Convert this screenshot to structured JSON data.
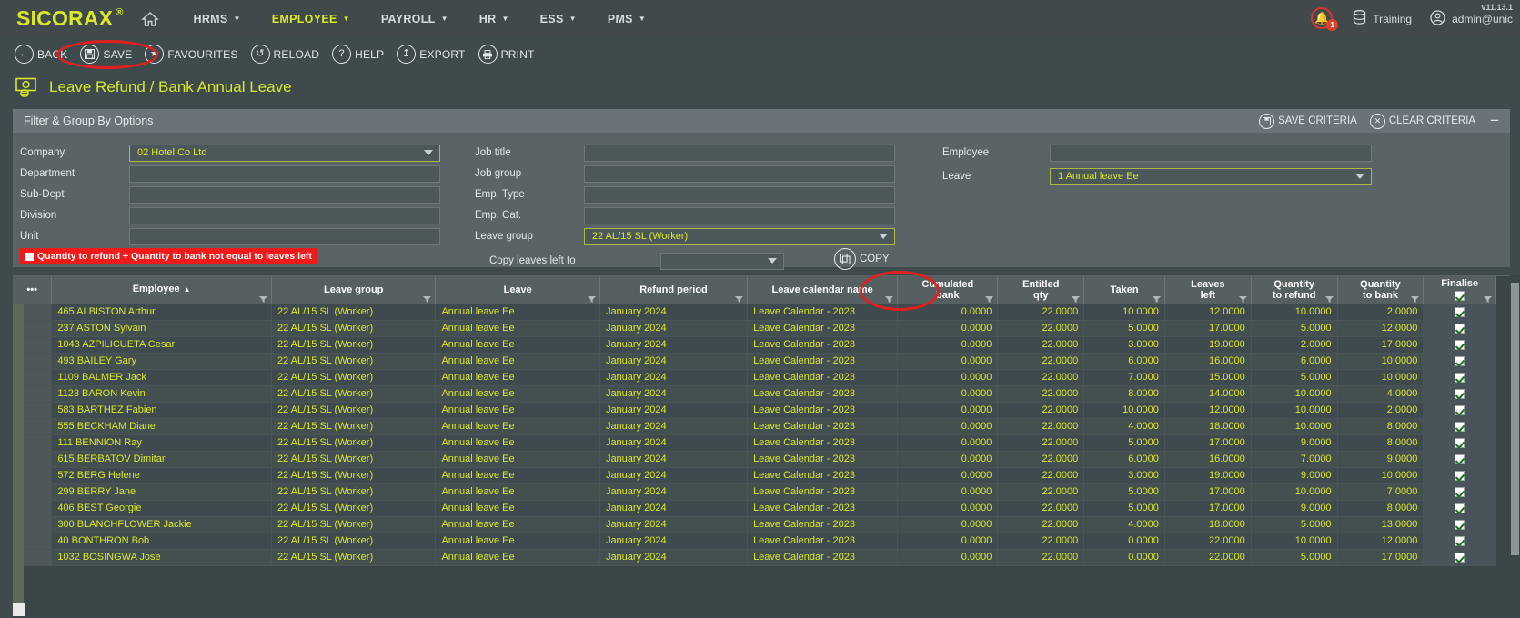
{
  "topnav": {
    "brand": "SICORAX",
    "brand_reg": "®",
    "home_icon": "home-icon",
    "items": [
      {
        "label": "HRMS",
        "active": false
      },
      {
        "label": "EMPLOYEE",
        "active": true
      },
      {
        "label": "PAYROLL",
        "active": false
      },
      {
        "label": "HR",
        "active": false
      },
      {
        "label": "ESS",
        "active": false
      },
      {
        "label": "PMS",
        "active": false
      }
    ],
    "notifications_count": "1",
    "database_label": "Training",
    "user_label": "admin@unic",
    "version": "v11.13.1",
    "progress_colors": [
      "#31a8bf",
      "#e8701a",
      "#e8c420",
      "#8cc44a"
    ]
  },
  "breadcrumb": {
    "module": "EMPLOYEE",
    "separator": "/",
    "page": "Leave refund / bank annual leave"
  },
  "toolbar": {
    "buttons": [
      {
        "label": "BACK",
        "icon": "arrow-left-icon"
      },
      {
        "label": "SAVE",
        "icon": "floppy-disk-icon"
      },
      {
        "label": "FAVOURITES",
        "icon": "star-icon"
      },
      {
        "label": "RELOAD",
        "icon": "refresh-icon"
      },
      {
        "label": "HELP",
        "icon": "question-mark-icon"
      },
      {
        "label": "EXPORT",
        "icon": "upload-icon"
      },
      {
        "label": "PRINT",
        "icon": "printer-icon"
      }
    ]
  },
  "page": {
    "title": "Leave Refund / Bank Annual Leave",
    "title_icon": "money-leave-icon"
  },
  "filter": {
    "header_title": "Filter & Group By Options",
    "save_criteria_label": "SAVE CRITERIA",
    "clear_criteria_label": "CLEAR CRITERIA",
    "collapse_label": "−",
    "left_fields": [
      {
        "label": "Company",
        "value": "02 Hotel Co Ltd",
        "dropdown": true,
        "highlight": true
      },
      {
        "label": "Department",
        "value": "",
        "dropdown": false,
        "highlight": false
      },
      {
        "label": "Sub-Dept",
        "value": "",
        "dropdown": false,
        "highlight": false
      },
      {
        "label": "Division",
        "value": "",
        "dropdown": false,
        "highlight": false
      },
      {
        "label": "Unit",
        "value": "",
        "dropdown": false,
        "highlight": false
      }
    ],
    "mid_fields": [
      {
        "label": "Job title",
        "value": "",
        "dropdown": false,
        "highlight": false
      },
      {
        "label": "Job group",
        "value": "",
        "dropdown": false,
        "highlight": false
      },
      {
        "label": "Emp. Type",
        "value": "",
        "dropdown": false,
        "highlight": false
      },
      {
        "label": "Emp. Cat.",
        "value": "",
        "dropdown": false,
        "highlight": false
      },
      {
        "label": "Leave group",
        "value": "22 AL/15 SL (Worker)",
        "dropdown": true,
        "highlight": true
      }
    ],
    "right_fields": [
      {
        "label": "Employee",
        "value": "",
        "dropdown": false,
        "highlight": false
      },
      {
        "label": "Leave",
        "value": "1 Annual leave Ee",
        "dropdown": true,
        "highlight": true
      }
    ],
    "copy_row": {
      "label": "Copy leaves left to",
      "value": "",
      "button_label": "COPY"
    },
    "warning": "Quantity to refund + Quantity to bank not equal to leaves left"
  },
  "grid": {
    "menu_icon": "ellipsis-icon",
    "columns": [
      {
        "line1": "Employee",
        "line2": "",
        "sorted": "asc"
      },
      {
        "line1": "Leave group",
        "line2": "",
        "sorted": ""
      },
      {
        "line1": "Leave",
        "line2": "",
        "sorted": ""
      },
      {
        "line1": "Refund period",
        "line2": "",
        "sorted": ""
      },
      {
        "line1": "Leave calendar name",
        "line2": "",
        "sorted": ""
      },
      {
        "line1": "Cumulated",
        "line2": "bank",
        "sorted": ""
      },
      {
        "line1": "Entitled",
        "line2": "qty",
        "sorted": ""
      },
      {
        "line1": "Taken",
        "line2": "",
        "sorted": ""
      },
      {
        "line1": "Leaves",
        "line2": "left",
        "sorted": ""
      },
      {
        "line1": "Quantity",
        "line2": "to refund",
        "sorted": ""
      },
      {
        "line1": "Quantity",
        "line2": "to bank",
        "sorted": ""
      },
      {
        "line1": "Finalise",
        "line2": "",
        "sorted": ""
      }
    ],
    "header_checkbox_checked": true,
    "rows": [
      {
        "employee": "465 ALBISTON Arthur",
        "leave_group": "22 AL/15 SL (Worker)",
        "leave": "Annual leave Ee",
        "refund_period": "January 2024",
        "calendar": "Leave Calendar - 2023",
        "cumulated_bank": "0.0000",
        "entitled_qty": "22.0000",
        "taken": "10.0000",
        "leaves_left": "12.0000",
        "qty_refund": "10.0000",
        "qty_bank": "2.0000",
        "finalise": true
      },
      {
        "employee": "237 ASTON Sylvain",
        "leave_group": "22 AL/15 SL (Worker)",
        "leave": "Annual leave Ee",
        "refund_period": "January 2024",
        "calendar": "Leave Calendar - 2023",
        "cumulated_bank": "0.0000",
        "entitled_qty": "22.0000",
        "taken": "5.0000",
        "leaves_left": "17.0000",
        "qty_refund": "5.0000",
        "qty_bank": "12.0000",
        "finalise": true
      },
      {
        "employee": "1043 AZPILICUETA Cesar",
        "leave_group": "22 AL/15 SL (Worker)",
        "leave": "Annual leave Ee",
        "refund_period": "January 2024",
        "calendar": "Leave Calendar - 2023",
        "cumulated_bank": "0.0000",
        "entitled_qty": "22.0000",
        "taken": "3.0000",
        "leaves_left": "19.0000",
        "qty_refund": "2.0000",
        "qty_bank": "17.0000",
        "finalise": true
      },
      {
        "employee": "493 BAILEY Gary",
        "leave_group": "22 AL/15 SL (Worker)",
        "leave": "Annual leave Ee",
        "refund_period": "January 2024",
        "calendar": "Leave Calendar - 2023",
        "cumulated_bank": "0.0000",
        "entitled_qty": "22.0000",
        "taken": "6.0000",
        "leaves_left": "16.0000",
        "qty_refund": "6.0000",
        "qty_bank": "10.0000",
        "finalise": true
      },
      {
        "employee": "1109 BALMER Jack",
        "leave_group": "22 AL/15 SL (Worker)",
        "leave": "Annual leave Ee",
        "refund_period": "January 2024",
        "calendar": "Leave Calendar - 2023",
        "cumulated_bank": "0.0000",
        "entitled_qty": "22.0000",
        "taken": "7.0000",
        "leaves_left": "15.0000",
        "qty_refund": "5.0000",
        "qty_bank": "10.0000",
        "finalise": true
      },
      {
        "employee": "1123 BARON Kevin",
        "leave_group": "22 AL/15 SL (Worker)",
        "leave": "Annual leave Ee",
        "refund_period": "January 2024",
        "calendar": "Leave Calendar - 2023",
        "cumulated_bank": "0.0000",
        "entitled_qty": "22.0000",
        "taken": "8.0000",
        "leaves_left": "14.0000",
        "qty_refund": "10.0000",
        "qty_bank": "4.0000",
        "finalise": true
      },
      {
        "employee": "583 BARTHEZ Fabien",
        "leave_group": "22 AL/15 SL (Worker)",
        "leave": "Annual leave Ee",
        "refund_period": "January 2024",
        "calendar": "Leave Calendar - 2023",
        "cumulated_bank": "0.0000",
        "entitled_qty": "22.0000",
        "taken": "10.0000",
        "leaves_left": "12.0000",
        "qty_refund": "10.0000",
        "qty_bank": "2.0000",
        "finalise": true
      },
      {
        "employee": "555 BECKHAM Diane",
        "leave_group": "22 AL/15 SL (Worker)",
        "leave": "Annual leave Ee",
        "refund_period": "January 2024",
        "calendar": "Leave Calendar - 2023",
        "cumulated_bank": "0.0000",
        "entitled_qty": "22.0000",
        "taken": "4.0000",
        "leaves_left": "18.0000",
        "qty_refund": "10.0000",
        "qty_bank": "8.0000",
        "finalise": true
      },
      {
        "employee": "111 BENNION Ray",
        "leave_group": "22 AL/15 SL (Worker)",
        "leave": "Annual leave Ee",
        "refund_period": "January 2024",
        "calendar": "Leave Calendar - 2023",
        "cumulated_bank": "0.0000",
        "entitled_qty": "22.0000",
        "taken": "5.0000",
        "leaves_left": "17.0000",
        "qty_refund": "9.0000",
        "qty_bank": "8.0000",
        "finalise": true
      },
      {
        "employee": "615 BERBATOV Dimitar",
        "leave_group": "22 AL/15 SL (Worker)",
        "leave": "Annual leave Ee",
        "refund_period": "January 2024",
        "calendar": "Leave Calendar - 2023",
        "cumulated_bank": "0.0000",
        "entitled_qty": "22.0000",
        "taken": "6.0000",
        "leaves_left": "16.0000",
        "qty_refund": "7.0000",
        "qty_bank": "9.0000",
        "finalise": true
      },
      {
        "employee": "572 BERG Helene",
        "leave_group": "22 AL/15 SL (Worker)",
        "leave": "Annual leave Ee",
        "refund_period": "January 2024",
        "calendar": "Leave Calendar - 2023",
        "cumulated_bank": "0.0000",
        "entitled_qty": "22.0000",
        "taken": "3.0000",
        "leaves_left": "19.0000",
        "qty_refund": "9.0000",
        "qty_bank": "10.0000",
        "finalise": true
      },
      {
        "employee": "299 BERRY Jane",
        "leave_group": "22 AL/15 SL (Worker)",
        "leave": "Annual leave Ee",
        "refund_period": "January 2024",
        "calendar": "Leave Calendar - 2023",
        "cumulated_bank": "0.0000",
        "entitled_qty": "22.0000",
        "taken": "5.0000",
        "leaves_left": "17.0000",
        "qty_refund": "10.0000",
        "qty_bank": "7.0000",
        "finalise": true
      },
      {
        "employee": "406 BEST Georgie",
        "leave_group": "22 AL/15 SL (Worker)",
        "leave": "Annual leave Ee",
        "refund_period": "January 2024",
        "calendar": "Leave Calendar - 2023",
        "cumulated_bank": "0.0000",
        "entitled_qty": "22.0000",
        "taken": "5.0000",
        "leaves_left": "17.0000",
        "qty_refund": "9.0000",
        "qty_bank": "8.0000",
        "finalise": true
      },
      {
        "employee": "300 BLANCHFLOWER Jackie",
        "leave_group": "22 AL/15 SL (Worker)",
        "leave": "Annual leave Ee",
        "refund_period": "January 2024",
        "calendar": "Leave Calendar - 2023",
        "cumulated_bank": "0.0000",
        "entitled_qty": "22.0000",
        "taken": "4.0000",
        "leaves_left": "18.0000",
        "qty_refund": "5.0000",
        "qty_bank": "13.0000",
        "finalise": true
      },
      {
        "employee": "40 BONTHRON Bob",
        "leave_group": "22 AL/15 SL (Worker)",
        "leave": "Annual leave Ee",
        "refund_period": "January 2024",
        "calendar": "Leave Calendar - 2023",
        "cumulated_bank": "0.0000",
        "entitled_qty": "22.0000",
        "taken": "0.0000",
        "leaves_left": "22.0000",
        "qty_refund": "10.0000",
        "qty_bank": "12.0000",
        "finalise": true
      },
      {
        "employee": "1032 BOSINGWA Jose",
        "leave_group": "22 AL/15 SL (Worker)",
        "leave": "Annual leave Ee",
        "refund_period": "January 2024",
        "calendar": "Leave Calendar - 2023",
        "cumulated_bank": "0.0000",
        "entitled_qty": "22.0000",
        "taken": "0.0000",
        "leaves_left": "22.0000",
        "qty_refund": "5.0000",
        "qty_bank": "17.0000",
        "finalise": true
      }
    ]
  }
}
